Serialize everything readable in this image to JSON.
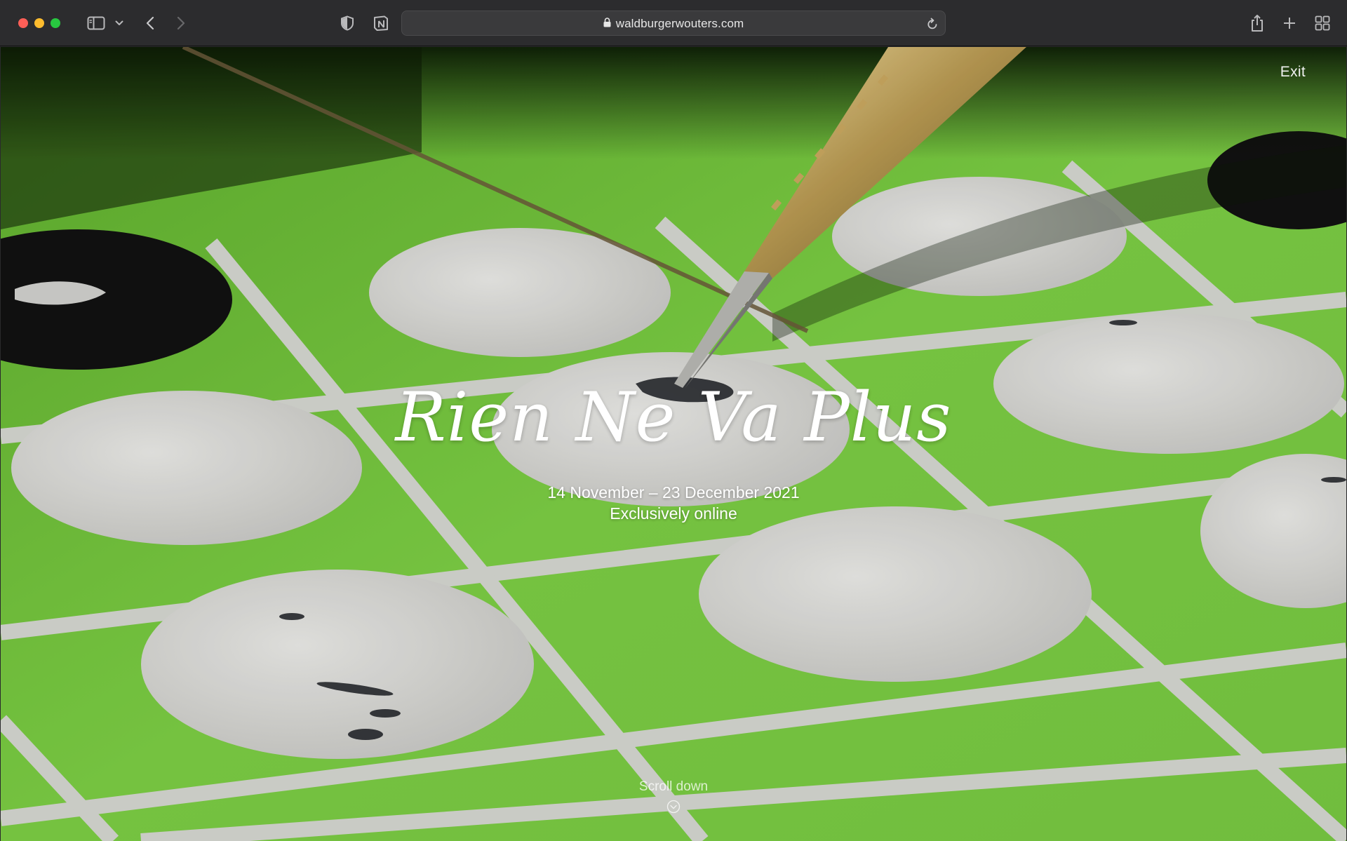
{
  "browser": {
    "url": "waldburgerwouters.com",
    "icons": {
      "sidebar": "sidebar-icon",
      "chevron": "chevron-down-icon",
      "back": "back-arrow-icon",
      "forward": "forward-arrow-icon",
      "privacy": "shield-icon",
      "extension": "notion-icon",
      "lock": "lock-icon",
      "reload": "reload-icon",
      "share": "share-icon",
      "new_tab": "plus-icon",
      "tab_overview": "grid-icon"
    }
  },
  "page": {
    "exit_label": "Exit",
    "title": "Rien Ne Va Plus",
    "dates": "14 November – 23 December 2021",
    "subtitle": "Exclusively online",
    "scroll_label": "Scroll down",
    "colors": {
      "felt_green": "#7ccf44",
      "circle_grey": "#d9d9d6",
      "text": "#ffffff"
    }
  }
}
